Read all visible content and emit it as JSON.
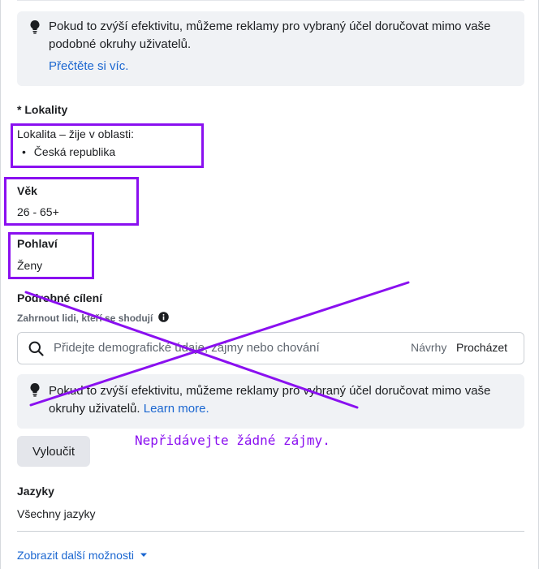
{
  "notice_top": {
    "text": "Pokud to zvýší efektivitu, můžeme reklamy pro vybraný účel doručovat mimo vaše podobné okruhy uživatelů.",
    "link": "Přečtěte si víc."
  },
  "locations": {
    "label": "* Lokality",
    "line": "Lokalita – žije v oblasti:",
    "items": [
      "Česká republika"
    ]
  },
  "age": {
    "label": "Věk",
    "value": "26 - 65+"
  },
  "gender": {
    "label": "Pohlaví",
    "value": "Ženy"
  },
  "detailed": {
    "label": "Podrobné cílení",
    "include_label": "Zahrnout lidi, kteří se shodují",
    "search_placeholder": "Přidejte demografické údaje, zájmy nebo chování",
    "suggestions": "Návrhy",
    "browse": "Procházet"
  },
  "notice_bottom": {
    "text": "Pokud to zvýší efektivitu, můžeme reklamy pro vybraný účel doručovat mimo vaše okruhy uživatelů.",
    "link": "Learn more."
  },
  "exclude_button": "Vyloučit",
  "annotation": "Nepřidávejte žádné zájmy.",
  "languages": {
    "label": "Jazyky",
    "value": "Všechny jazyky"
  },
  "more_options": "Zobrazit další možnosti",
  "colors": {
    "annotation": "#8a10f0",
    "link": "#1a66d0",
    "panel": "#f0f2f5"
  }
}
